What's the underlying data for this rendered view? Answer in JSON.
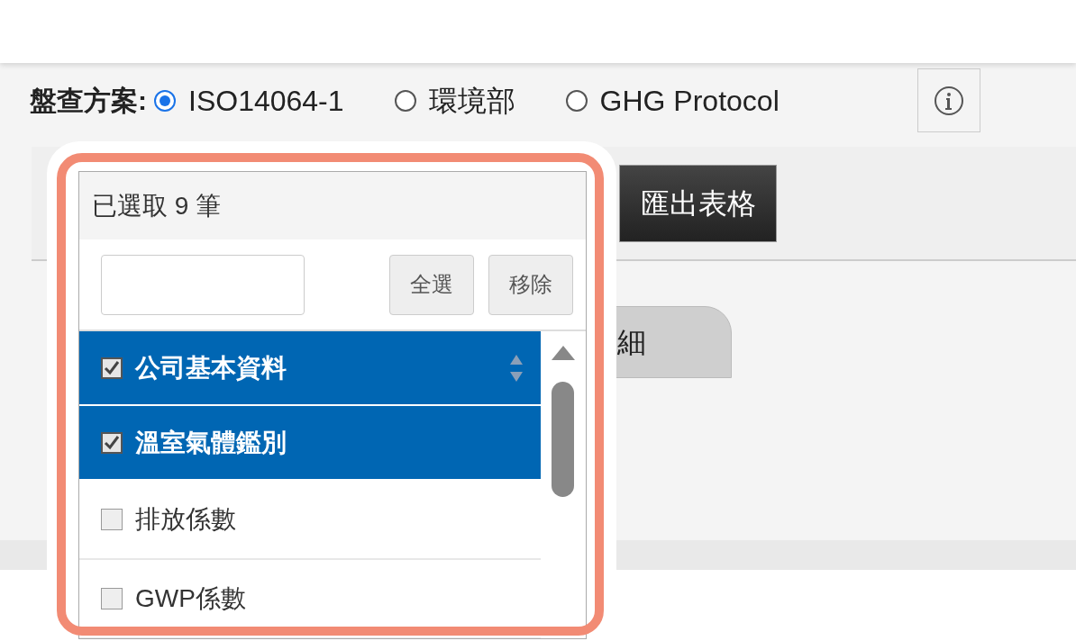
{
  "scheme": {
    "label": "盤查方案:",
    "options": [
      {
        "label": "ISO14064-1",
        "selected": true
      },
      {
        "label": "環境部",
        "selected": false
      },
      {
        "label": "GHG Protocol",
        "selected": false
      }
    ]
  },
  "export_button": "匯出表格",
  "tab": {
    "label": "細"
  },
  "multiselect": {
    "summary": "已選取 9 筆",
    "select_all": "全選",
    "remove": "移除",
    "items": [
      {
        "label": "公司基本資料",
        "checked": true,
        "hovered": true
      },
      {
        "label": "溫室氣體鑑別",
        "checked": true,
        "hovered": false
      },
      {
        "label": "排放係數",
        "checked": false,
        "hovered": false
      },
      {
        "label": "GWP係數",
        "checked": false,
        "hovered": false
      }
    ]
  }
}
